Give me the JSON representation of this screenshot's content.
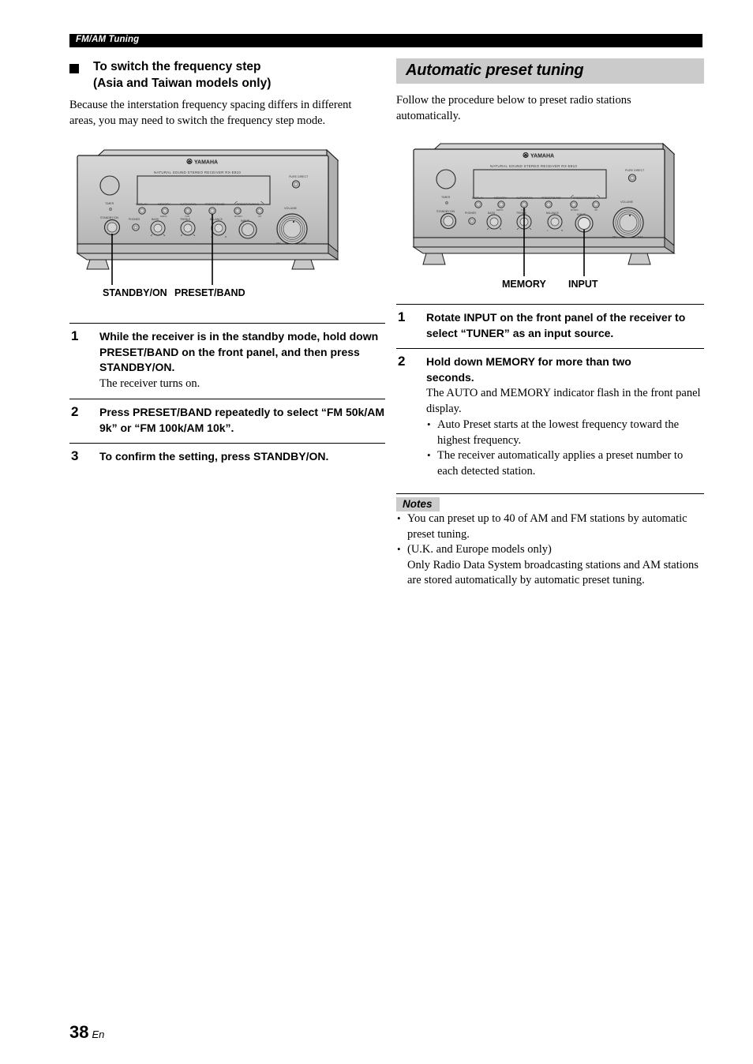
{
  "running_head": {
    "text": "FM/AM Tuning"
  },
  "left_column": {
    "heading": "To switch the frequency step (Asia and Taiwan models only)",
    "heading_line1": "To switch the frequency step",
    "heading_line2": "(Asia and Taiwan models only)",
    "intro": "Because the interstation frequency spacing differs in different areas, you may need to switch the frequency step mode.",
    "figure": {
      "brand": "YAMAHA",
      "model_line": "NATURAL SOUND STEREO RECEIVER  RX-E810",
      "panel_labels": {
        "timer": "TIMER",
        "standby_on": "STANDBY/ON",
        "phones": "PHONES",
        "bass": "BASS",
        "treble": "TREBLE",
        "balance": "BALANCE",
        "input": "INPUT",
        "volume": "VOLUME",
        "volume_min": "MIN",
        "volume_max": "MAX",
        "display": "DISPLAY",
        "memory": "MEMORY",
        "auto_manl": "AUTO/MAN'L",
        "preset_band": "PRESET/BAND",
        "preset_tuning": "PRESET/TUNING",
        "pure_direct": "PURE DIRECT",
        "sub_man": "MAN'L",
        "sub_tun": "TUN",
        "sub_edit": "EDIT",
        "sub_down": "DOWN",
        "sub_up": "UP",
        "bal_l": "L",
        "bal_r": "R"
      },
      "callouts": [
        {
          "label": "STANDBY/ON"
        },
        {
          "label": "PRESET/BAND"
        }
      ]
    },
    "steps": [
      {
        "num": "1",
        "title": "While the receiver is in the standby mode, hold down PRESET/BAND on the front panel, and then press STANDBY/ON.",
        "sub": "The receiver turns on."
      },
      {
        "num": "2",
        "title": "Press PRESET/BAND repeatedly to select “FM 50k/AM 9k” or “FM 100k/AM 10k”.",
        "sub": ""
      },
      {
        "num": "3",
        "title": "To confirm the setting, press STANDBY/ON.",
        "sub": ""
      }
    ]
  },
  "right_column": {
    "section_title": "Automatic preset tuning",
    "intro": "Follow the procedure below to preset radio stations automatically.",
    "figure": {
      "brand": "YAMAHA",
      "model_line": "NATURAL SOUND STEREO RECEIVER  RX-E810",
      "callouts": [
        {
          "label": "MEMORY"
        },
        {
          "label": "INPUT"
        }
      ]
    },
    "steps": [
      {
        "num": "1",
        "title": "Rotate INPUT on the front panel of the receiver to select “TUNER” as an input source.",
        "sub": ""
      },
      {
        "num": "2",
        "title": "Hold down MEMORY for more than two seconds.",
        "sub": "The AUTO and MEMORY indicator flash in the front panel display.",
        "bullets": [
          "Auto Preset starts at the lowest frequency toward the highest frequency.",
          "The receiver automatically applies a preset number to each detected station."
        ]
      }
    ],
    "notes": {
      "heading": "Notes",
      "items": [
        "You can preset up to 40 of AM and FM stations by automatic preset tuning.",
        "(U.K. and Europe models only)"
      ],
      "item2_continuation": "Only Radio Data System broadcasting stations and AM stations are stored automatically by automatic preset tuning."
    }
  },
  "footer": {
    "page_number": "38",
    "language": "En"
  },
  "colors": {
    "banner_gray": "#cbcbcb",
    "runhead_black": "#000000",
    "panel_gray": "#c8c8c8",
    "panel_gray_dark": "#a9a9a9"
  }
}
